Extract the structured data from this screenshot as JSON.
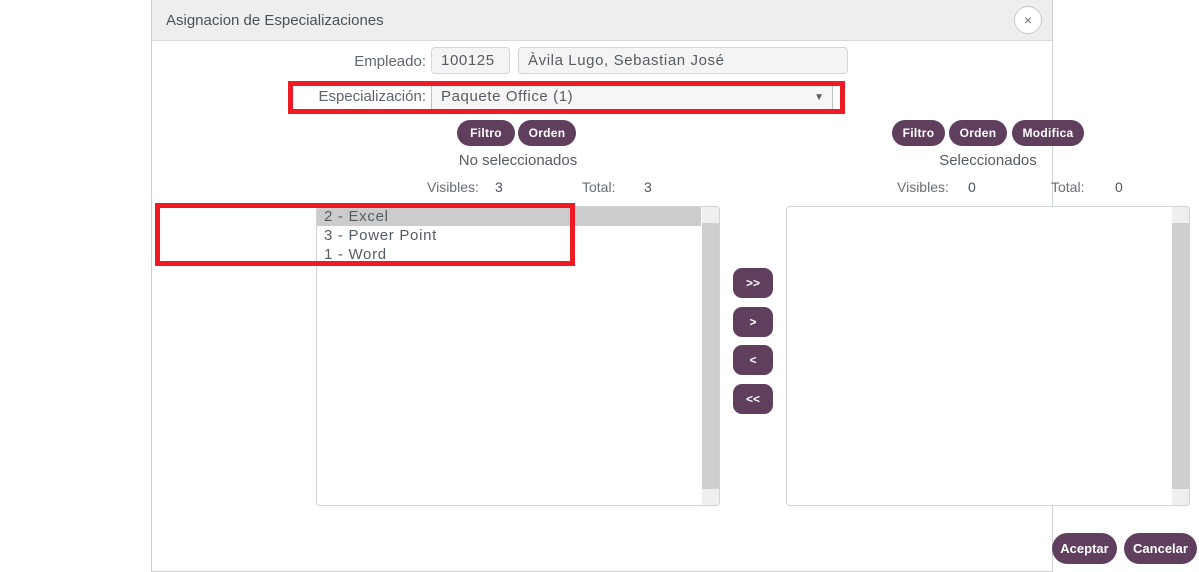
{
  "dialog": {
    "title": "Asignacion de Especializaciones",
    "close_icon": "close-icon",
    "close_glyph": "×"
  },
  "header": {
    "empleado_label": "Empleado:",
    "empleado_id": "100125",
    "empleado_name": "Àvila Lugo, Sebastian José",
    "especializacion_label": "Especialización:",
    "especializacion_value": "Paquete Office (1)",
    "caret_glyph": "▼"
  },
  "left_panel": {
    "filtro_label": "Filtro",
    "orden_label": "Orden",
    "title": "No seleccionados",
    "visibles_label": "Visibles:",
    "visibles_value": "3",
    "total_label": "Total:",
    "total_value": "3",
    "items": [
      {
        "label": "2 - Excel",
        "selected": true
      },
      {
        "label": "3 - Power Point",
        "selected": false
      },
      {
        "label": "1 - Word",
        "selected": false
      }
    ]
  },
  "right_panel": {
    "filtro_label": "Filtro",
    "orden_label": "Orden",
    "modifica_label": "Modifica",
    "title": "Seleccionados",
    "visibles_label": "Visibles:",
    "visibles_value": "0",
    "total_label": "Total:",
    "total_value": "0",
    "items": []
  },
  "transfer": {
    "all_right": ">>",
    "right": ">",
    "left": "<",
    "all_left": "<<"
  },
  "footer": {
    "aceptar_label": "Aceptar",
    "cancelar_label": "Cancelar"
  },
  "colors": {
    "accent_purple": "#5f3f5d",
    "annotation_red": "#ee1b24",
    "titlebar_gray": "#eeeeee",
    "selection_gray": "#cccccc"
  }
}
